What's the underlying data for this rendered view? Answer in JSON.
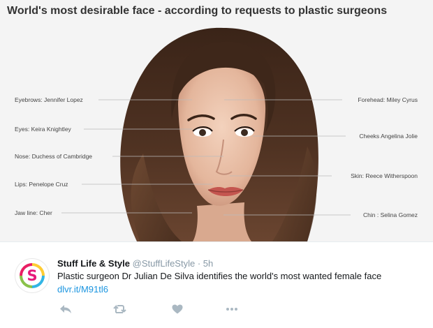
{
  "media": {
    "title": "World's most desirable face - according to requests to plastic surgeons",
    "annotations_left": [
      "Eyebrows: Jennifer Lopez",
      "Eyes: Keira Knightley",
      "Nose: Duchess of Cambridge",
      "Lips: Penelope Cruz",
      "Jaw line: Cher"
    ],
    "annotations_right": [
      "Forehead: Miley Cyrus",
      "Cheeks Angelina Jolie",
      "Skin: Reece Witherspoon",
      "Chin : Selina Gomez"
    ]
  },
  "tweet": {
    "avatar_letter": "S",
    "display_name": "Stuff Life & Style",
    "handle": "@StuffLifeStyle",
    "separator": "·",
    "time": "5h",
    "text": "Plastic surgeon Dr Julian De Silva identifies the world's most wanted female face",
    "link": "dlvr.it/M91tl6"
  },
  "icons": {
    "reply": "reply-icon",
    "retweet": "retweet-icon",
    "like": "heart-icon",
    "more": "more-icon"
  },
  "colors": {
    "link": "#1b95e0",
    "muted": "#8899a6",
    "avatar_accent": "#e6197a"
  }
}
